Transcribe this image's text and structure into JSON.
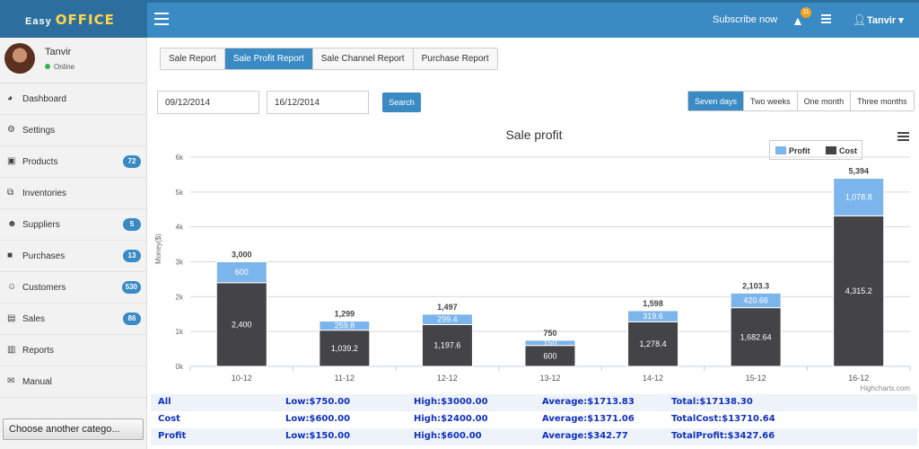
{
  "header": {
    "logo_easy": "Easy",
    "logo_office": "OFFICE",
    "subscribe": "Subscribe now",
    "alert_count": "11",
    "user": "Tanvir"
  },
  "sidebar": {
    "profile_name": "Tanvir",
    "profile_status": "Online",
    "items": [
      {
        "label": "Dashboard",
        "icon": "dashboard-icon",
        "glyph": "◕",
        "count": null
      },
      {
        "label": "Settings",
        "icon": "gears-icon",
        "glyph": "⚙",
        "count": null
      },
      {
        "label": "Products",
        "icon": "gift-icon",
        "glyph": "▣",
        "count": "72"
      },
      {
        "label": "Inventories",
        "icon": "sitemap-icon",
        "glyph": "⧉",
        "count": null
      },
      {
        "label": "Suppliers",
        "icon": "users-icon",
        "glyph": "☻",
        "count": "5"
      },
      {
        "label": "Purchases",
        "icon": "truck-icon",
        "glyph": "■",
        "count": "13"
      },
      {
        "label": "Customers",
        "icon": "smile-icon",
        "glyph": "☺",
        "count": "530"
      },
      {
        "label": "Sales",
        "icon": "money-icon",
        "glyph": "▤",
        "count": "86"
      },
      {
        "label": "Reports",
        "icon": "bar-chart-icon",
        "glyph": "▥",
        "count": null
      },
      {
        "label": "Manual",
        "icon": "comments-icon",
        "glyph": "✉",
        "count": null
      }
    ],
    "other_category": "Choose another catego..."
  },
  "tabs": [
    "Sale Report",
    "Sale Profit Report",
    "Sale Channel Report",
    "Purchase Report"
  ],
  "filters": {
    "date_from": "09/12/2014",
    "date_to": "16/12/2014",
    "search_label": "Search",
    "ranges": [
      "Seven days",
      "Two weeks",
      "One month",
      "Three months"
    ]
  },
  "colors": {
    "accent": "#3a8ac4",
    "profit": "#7cb5ec",
    "cost": "#434348",
    "summary_text": "#1030c0"
  },
  "chart_data": {
    "type": "bar",
    "title": "Sale profit",
    "xlabel": "",
    "ylabel": "Money($)",
    "ylim": [
      0,
      6000
    ],
    "yticks": [
      "0k",
      "1k",
      "2k",
      "3k",
      "4k",
      "5k",
      "6k"
    ],
    "categories": [
      "10-12",
      "11-12",
      "12-12",
      "13-12",
      "14-12",
      "15-12",
      "16-12"
    ],
    "stacked": true,
    "legend": "top-right",
    "grid": true,
    "series": [
      {
        "name": "Profit",
        "values": [
          600,
          259.8,
          299.4,
          150,
          319.6,
          420.66,
          1078.8
        ],
        "labels": [
          "600",
          "259.8",
          "299.4",
          "150",
          "319.6",
          "420.66",
          "1,078.8"
        ]
      },
      {
        "name": "Cost",
        "values": [
          2400,
          1039.2,
          1197.6,
          600,
          1278.4,
          1682.64,
          4315.2
        ],
        "labels": [
          "2,400",
          "1,039.2",
          "1,197.6",
          "600",
          "1,278.4",
          "1,682.64",
          "4,315.2"
        ]
      }
    ],
    "totals": [
      "3,000",
      "1,299",
      "1,497",
      "750",
      "1,598",
      "2,103.3",
      "5,394"
    ],
    "credit": "Highcharts.com"
  },
  "summary": [
    {
      "name": "All",
      "low": "Low:$750.00",
      "high": "High:$3000.00",
      "avg": "Average:$1713.83",
      "total": "Total:$17138.30"
    },
    {
      "name": "Cost",
      "low": "Low:$600.00",
      "high": "High:$2400.00",
      "avg": "Average:$1371.06",
      "total": "TotalCost:$13710.64"
    },
    {
      "name": "Profit",
      "low": "Low:$150.00",
      "high": "High:$600.00",
      "avg": "Average:$342.77",
      "total": "TotalProfit:$3427.66"
    }
  ]
}
